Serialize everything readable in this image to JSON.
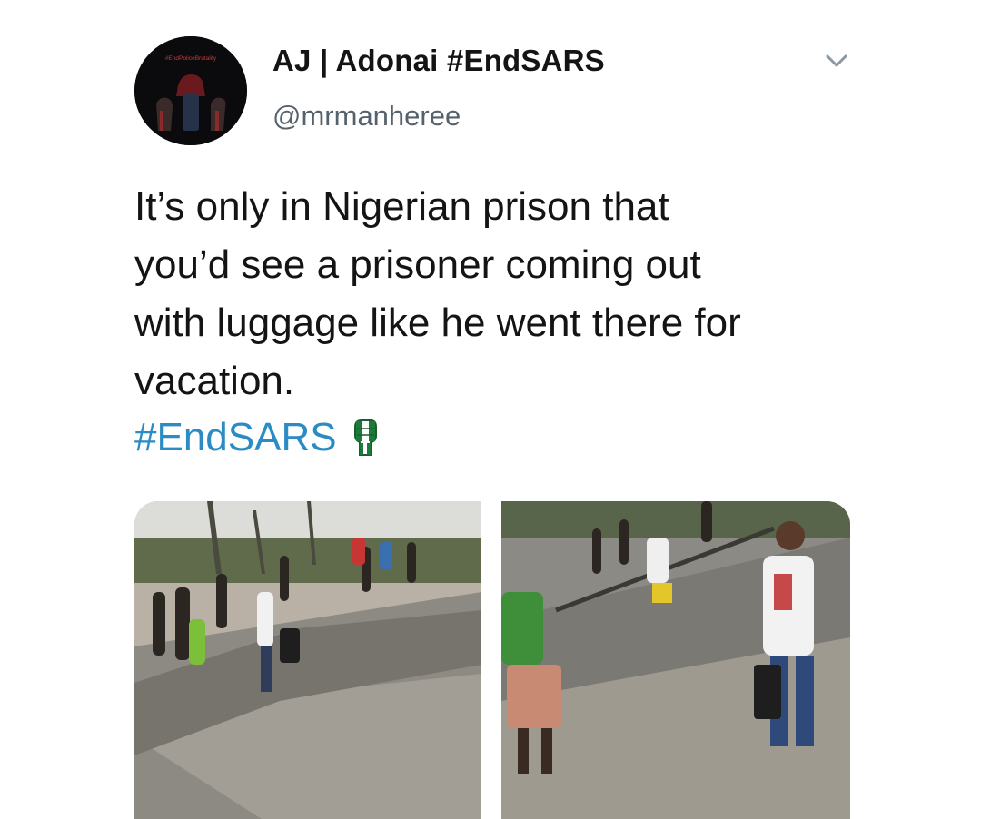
{
  "tweet": {
    "display_name": "AJ | Adonai #EndSARS",
    "handle": "@mrmanheree",
    "avatar_caption": "#EndPoliceBrutality",
    "text_lines": [
      "It’s only in Nigerian prison that",
      "you’d see a prisoner coming out",
      "with luggage like he went there for",
      "vacation."
    ],
    "hashtag": "#EndSARS",
    "emoji": "raised-fist-green-white-green-icon",
    "more_menu_icon": "chevron-down-icon",
    "media": [
      {
        "name": "photo-left",
        "depicts": "crowd-running-on-street"
      },
      {
        "name": "photo-right",
        "depicts": "man-in-white-singlet-on-road"
      }
    ]
  },
  "colors": {
    "link": "#2b8bc4",
    "handle": "#56616b",
    "text": "#141414",
    "avatar_bg": "#0b0b0d",
    "flag_green": "#1d7a3a"
  }
}
